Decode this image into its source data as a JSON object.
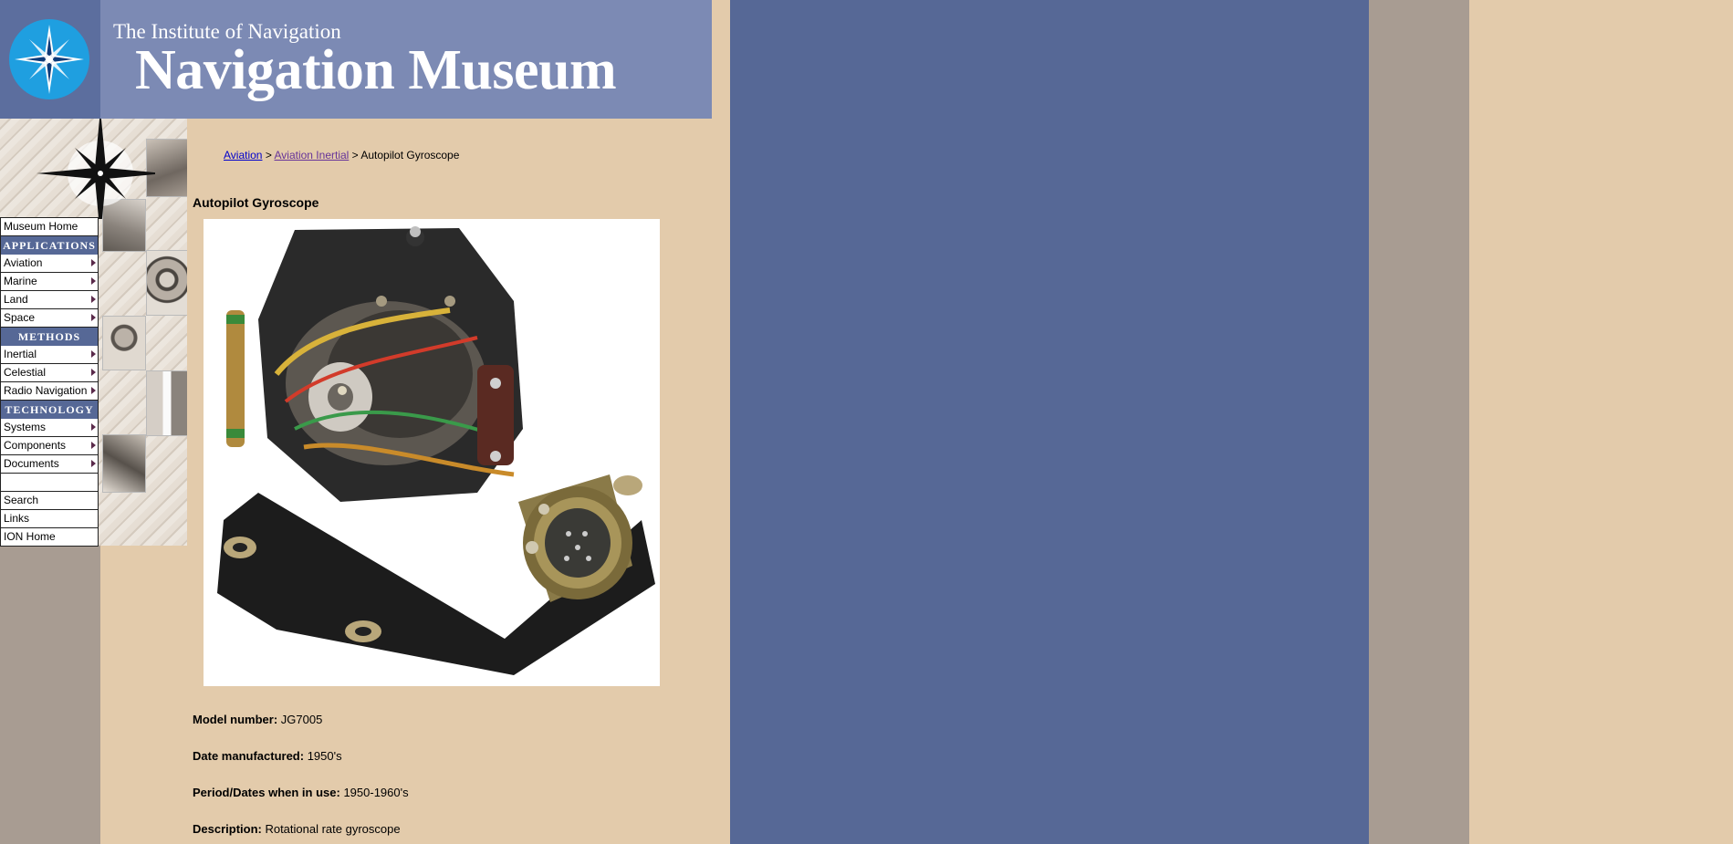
{
  "header": {
    "institute": "The Institute of Navigation",
    "title": "Navigation Museum"
  },
  "nav": {
    "home": "Museum Home",
    "sections": [
      {
        "heading": "APPLICATIONS",
        "items": [
          "Aviation",
          "Marine",
          "Land",
          "Space"
        ]
      },
      {
        "heading": "METHODS",
        "items": [
          "Inertial",
          "Celestial",
          "Radio Navigation"
        ]
      },
      {
        "heading": "TECHNOLOGY",
        "items": [
          "Systems",
          "Components",
          "Documents"
        ]
      }
    ],
    "footer_items": [
      "Search",
      "Links",
      "ION Home"
    ]
  },
  "breadcrumb": {
    "link1": "Aviation",
    "sep1": " > ",
    "link2": "Aviation Inertial",
    "sep2": " > ",
    "current": "Autopilot Gyroscope"
  },
  "page": {
    "title": "Autopilot Gyroscope"
  },
  "details": [
    {
      "label": "Model number:",
      "value": " JG7005"
    },
    {
      "label": "Date manufactured:",
      "value": " 1950's"
    },
    {
      "label": "Period/Dates when in use:",
      "value": " 1950-1960's"
    },
    {
      "label": "Description:",
      "value": " Rotational rate gyroscope"
    }
  ],
  "colors": {
    "tan": "#e3cbab",
    "blue": "#566896",
    "taupe": "#a89c92",
    "header": "#7c8ab4"
  }
}
